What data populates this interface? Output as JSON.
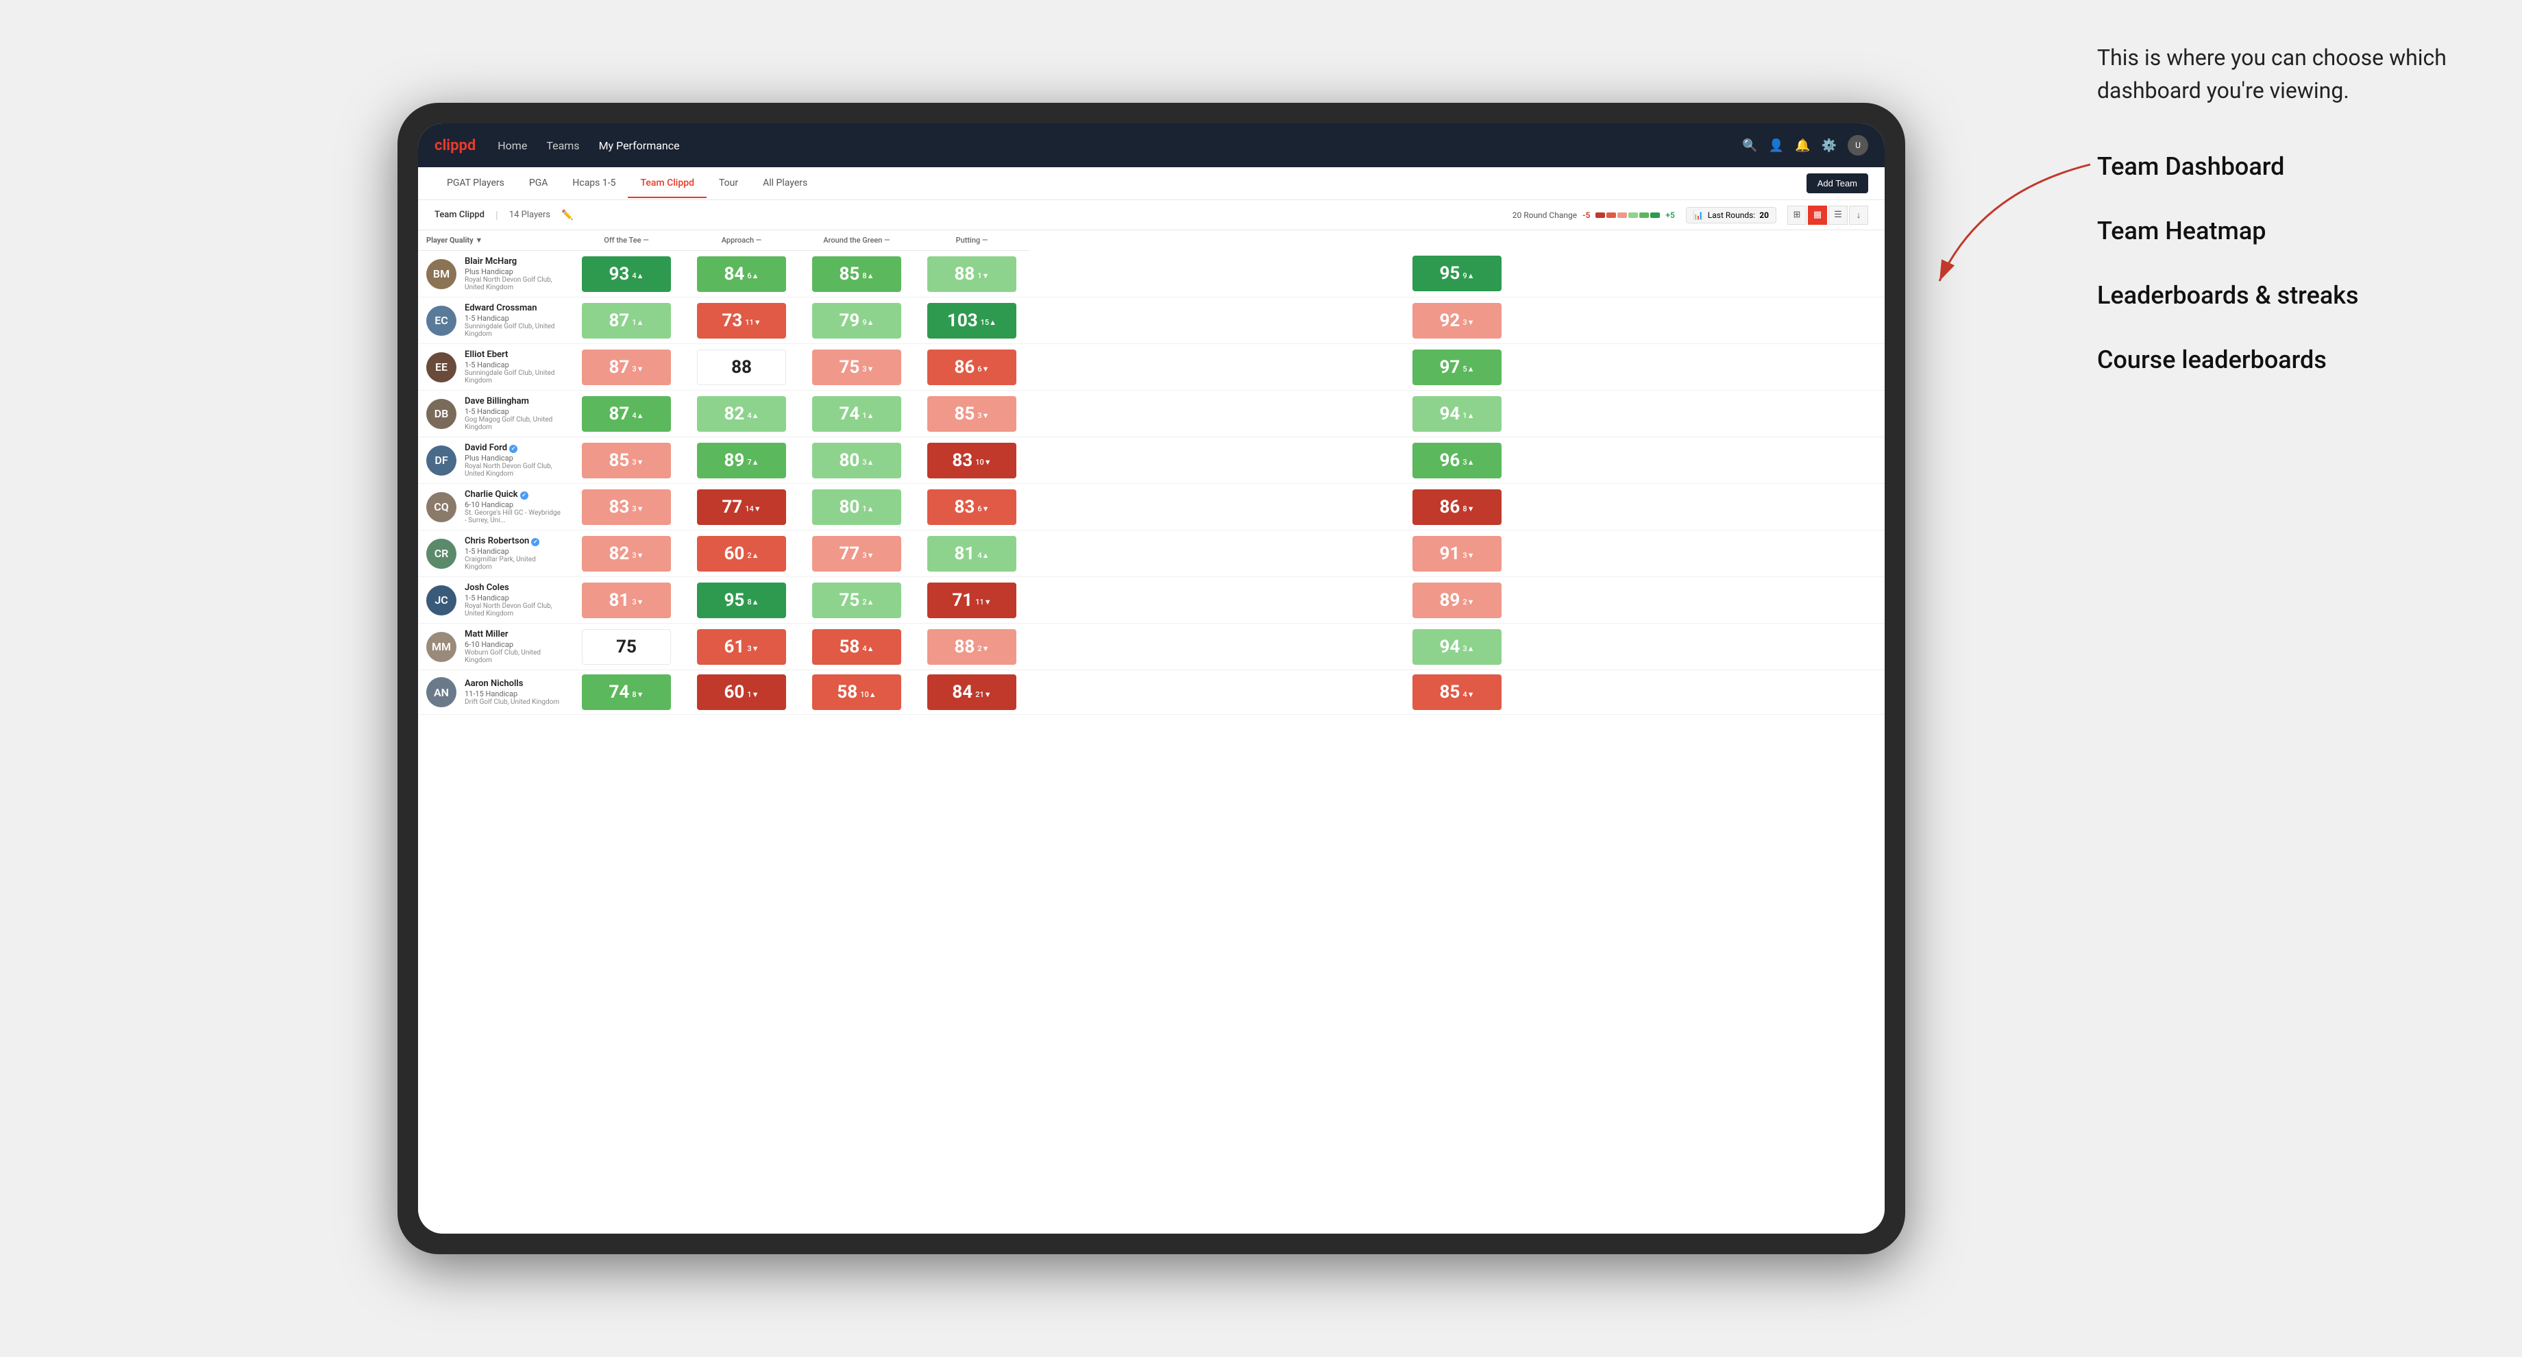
{
  "app": {
    "brand": "clippd",
    "nav": {
      "items": [
        {
          "label": "Home",
          "active": false
        },
        {
          "label": "Teams",
          "active": false
        },
        {
          "label": "My Performance",
          "active": true
        }
      ]
    }
  },
  "tabs": [
    {
      "label": "PGAT Players",
      "active": false
    },
    {
      "label": "PGA",
      "active": false
    },
    {
      "label": "Hcaps 1-5",
      "active": false
    },
    {
      "label": "Team Clippd",
      "active": true
    },
    {
      "label": "Tour",
      "active": false
    },
    {
      "label": "All Players",
      "active": false
    }
  ],
  "add_team_label": "Add Team",
  "sub_bar": {
    "team_name": "Team Clippd",
    "separator": "|",
    "player_count": "14 Players",
    "round_change_label": "20 Round Change",
    "minus": "-5",
    "plus": "+5",
    "last_rounds_label": "Last Rounds:",
    "last_rounds_value": "20"
  },
  "table": {
    "headers": [
      {
        "label": "Player Quality",
        "key": "player_quality",
        "sort": true
      },
      {
        "label": "Off the Tee",
        "key": "off_tee",
        "sort": true
      },
      {
        "label": "Approach",
        "key": "approach",
        "sort": true
      },
      {
        "label": "Around the Green",
        "key": "around_green",
        "sort": true
      },
      {
        "label": "Putting",
        "key": "putting",
        "sort": true
      }
    ],
    "players": [
      {
        "name": "Blair McHarg",
        "handicap": "Plus Handicap",
        "club": "Royal North Devon Golf Club, United Kingdom",
        "avatar_color": "#8B7355",
        "initials": "BM",
        "verified": false,
        "player_quality": {
          "value": 93,
          "change": 4,
          "dir": "up",
          "color": "green-dark"
        },
        "off_tee": {
          "value": 84,
          "change": 6,
          "dir": "up",
          "color": "green-mid"
        },
        "approach": {
          "value": 85,
          "change": 8,
          "dir": "up",
          "color": "green-mid"
        },
        "around_green": {
          "value": 88,
          "change": 1,
          "dir": "down",
          "color": "green-light"
        },
        "putting": {
          "value": 95,
          "change": 9,
          "dir": "up",
          "color": "green-dark"
        }
      },
      {
        "name": "Edward Crossman",
        "handicap": "1-5 Handicap",
        "club": "Sunningdale Golf Club, United Kingdom",
        "avatar_color": "#5a7a9a",
        "initials": "EC",
        "verified": false,
        "player_quality": {
          "value": 87,
          "change": 1,
          "dir": "up",
          "color": "green-light"
        },
        "off_tee": {
          "value": 73,
          "change": 11,
          "dir": "down",
          "color": "red-mid"
        },
        "approach": {
          "value": 79,
          "change": 9,
          "dir": "up",
          "color": "green-light"
        },
        "around_green": {
          "value": 103,
          "change": 15,
          "dir": "up",
          "color": "green-dark"
        },
        "putting": {
          "value": 92,
          "change": 3,
          "dir": "down",
          "color": "red-light"
        }
      },
      {
        "name": "Elliot Ebert",
        "handicap": "1-5 Handicap",
        "club": "Sunningdale Golf Club, United Kingdom",
        "avatar_color": "#6a4a3a",
        "initials": "EE",
        "verified": false,
        "player_quality": {
          "value": 87,
          "change": 3,
          "dir": "down",
          "color": "red-light"
        },
        "off_tee": {
          "value": 88,
          "change": 0,
          "dir": "none",
          "color": "neutral"
        },
        "approach": {
          "value": 75,
          "change": 3,
          "dir": "down",
          "color": "red-light"
        },
        "around_green": {
          "value": 86,
          "change": 6,
          "dir": "down",
          "color": "red-mid"
        },
        "putting": {
          "value": 97,
          "change": 5,
          "dir": "up",
          "color": "green-mid"
        }
      },
      {
        "name": "Dave Billingham",
        "handicap": "1-5 Handicap",
        "club": "Gog Magog Golf Club, United Kingdom",
        "avatar_color": "#7a6a5a",
        "initials": "DB",
        "verified": false,
        "player_quality": {
          "value": 87,
          "change": 4,
          "dir": "up",
          "color": "green-mid"
        },
        "off_tee": {
          "value": 82,
          "change": 4,
          "dir": "up",
          "color": "green-light"
        },
        "approach": {
          "value": 74,
          "change": 1,
          "dir": "up",
          "color": "green-light"
        },
        "around_green": {
          "value": 85,
          "change": 3,
          "dir": "down",
          "color": "red-light"
        },
        "putting": {
          "value": 94,
          "change": 1,
          "dir": "up",
          "color": "green-light"
        }
      },
      {
        "name": "David Ford",
        "handicap": "Plus Handicap",
        "club": "Royal North Devon Golf Club, United Kingdom",
        "avatar_color": "#4a6a8a",
        "initials": "DF",
        "verified": true,
        "player_quality": {
          "value": 85,
          "change": 3,
          "dir": "down",
          "color": "red-light"
        },
        "off_tee": {
          "value": 89,
          "change": 7,
          "dir": "up",
          "color": "green-mid"
        },
        "approach": {
          "value": 80,
          "change": 3,
          "dir": "up",
          "color": "green-light"
        },
        "around_green": {
          "value": 83,
          "change": 10,
          "dir": "down",
          "color": "red-dark"
        },
        "putting": {
          "value": 96,
          "change": 3,
          "dir": "up",
          "color": "green-mid"
        }
      },
      {
        "name": "Charlie Quick",
        "handicap": "6-10 Handicap",
        "club": "St. George's Hill GC - Weybridge - Surrey, Uni...",
        "avatar_color": "#8a7a6a",
        "initials": "CQ",
        "verified": true,
        "player_quality": {
          "value": 83,
          "change": 3,
          "dir": "down",
          "color": "red-light"
        },
        "off_tee": {
          "value": 77,
          "change": 14,
          "dir": "down",
          "color": "red-dark"
        },
        "approach": {
          "value": 80,
          "change": 1,
          "dir": "up",
          "color": "green-light"
        },
        "around_green": {
          "value": 83,
          "change": 6,
          "dir": "down",
          "color": "red-mid"
        },
        "putting": {
          "value": 86,
          "change": 8,
          "dir": "down",
          "color": "red-dark"
        }
      },
      {
        "name": "Chris Robertson",
        "handicap": "1-5 Handicap",
        "club": "Craigmillar Park, United Kingdom",
        "avatar_color": "#5a8a6a",
        "initials": "CR",
        "verified": true,
        "player_quality": {
          "value": 82,
          "change": 3,
          "dir": "down",
          "color": "red-light"
        },
        "off_tee": {
          "value": 60,
          "change": 2,
          "dir": "up",
          "color": "red-mid"
        },
        "approach": {
          "value": 77,
          "change": 3,
          "dir": "down",
          "color": "red-light"
        },
        "around_green": {
          "value": 81,
          "change": 4,
          "dir": "up",
          "color": "green-light"
        },
        "putting": {
          "value": 91,
          "change": 3,
          "dir": "down",
          "color": "red-light"
        }
      },
      {
        "name": "Josh Coles",
        "handicap": "1-5 Handicap",
        "club": "Royal North Devon Golf Club, United Kingdom",
        "avatar_color": "#3a5a7a",
        "initials": "JC",
        "verified": false,
        "player_quality": {
          "value": 81,
          "change": 3,
          "dir": "down",
          "color": "red-light"
        },
        "off_tee": {
          "value": 95,
          "change": 8,
          "dir": "up",
          "color": "green-dark"
        },
        "approach": {
          "value": 75,
          "change": 2,
          "dir": "up",
          "color": "green-light"
        },
        "around_green": {
          "value": 71,
          "change": 11,
          "dir": "down",
          "color": "red-dark"
        },
        "putting": {
          "value": 89,
          "change": 2,
          "dir": "down",
          "color": "red-light"
        }
      },
      {
        "name": "Matt Miller",
        "handicap": "6-10 Handicap",
        "club": "Woburn Golf Club, United Kingdom",
        "avatar_color": "#9a8a7a",
        "initials": "MM",
        "verified": false,
        "player_quality": {
          "value": 75,
          "change": 0,
          "dir": "none",
          "color": "neutral"
        },
        "off_tee": {
          "value": 61,
          "change": 3,
          "dir": "down",
          "color": "red-mid"
        },
        "approach": {
          "value": 58,
          "change": 4,
          "dir": "up",
          "color": "red-mid"
        },
        "around_green": {
          "value": 88,
          "change": 2,
          "dir": "down",
          "color": "red-light"
        },
        "putting": {
          "value": 94,
          "change": 3,
          "dir": "up",
          "color": "green-light"
        }
      },
      {
        "name": "Aaron Nicholls",
        "handicap": "11-15 Handicap",
        "club": "Drift Golf Club, United Kingdom",
        "avatar_color": "#6a7a8a",
        "initials": "AN",
        "verified": false,
        "player_quality": {
          "value": 74,
          "change": 8,
          "dir": "down",
          "color": "green-mid"
        },
        "off_tee": {
          "value": 60,
          "change": 1,
          "dir": "down",
          "color": "red-dark"
        },
        "approach": {
          "value": 58,
          "change": 10,
          "dir": "up",
          "color": "red-mid"
        },
        "around_green": {
          "value": 84,
          "change": 21,
          "dir": "down",
          "color": "red-dark"
        },
        "putting": {
          "value": 85,
          "change": 4,
          "dir": "down",
          "color": "red-mid"
        }
      }
    ]
  },
  "annotation": {
    "intro": "This is where you can choose which dashboard you're viewing.",
    "menu_items": [
      "Team Dashboard",
      "Team Heatmap",
      "Leaderboards & streaks",
      "Course leaderboards"
    ]
  }
}
